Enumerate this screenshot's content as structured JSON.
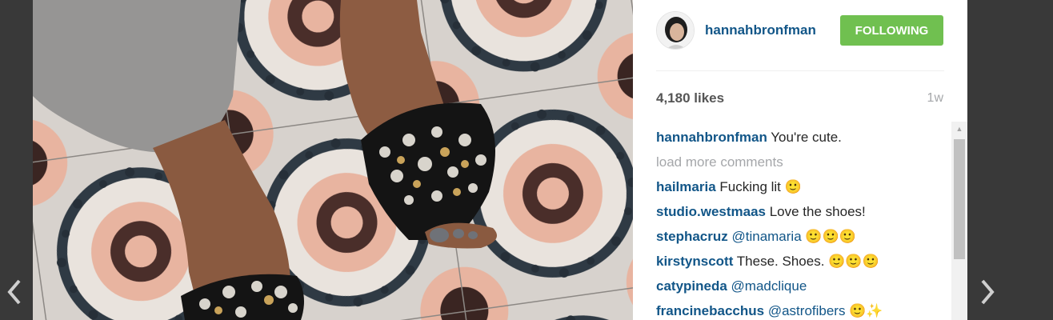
{
  "post": {
    "username": "hannahbronfman",
    "follow_label": "FOLLOWING",
    "likes": "4,180 likes",
    "age": "1w"
  },
  "comments": {
    "load_more": "load more comments",
    "items": [
      {
        "author": "hannahbronfman",
        "mention": "",
        "text": " You're cute."
      },
      {
        "author": "hailmaria",
        "mention": "",
        "text": " Fucking lit 🙂"
      },
      {
        "author": "studio.westmaas",
        "mention": "",
        "text": " Love the shoes!"
      },
      {
        "author": "stephacruz",
        "mention": "@tinamaria",
        "text": " 🙂🙂🙂"
      },
      {
        "author": "kirstynscott",
        "mention": "",
        "text": " These. Shoes. 🙂🙂🙂"
      },
      {
        "author": "catypineda",
        "mention": "@madclique",
        "text": ""
      },
      {
        "author": "francinebacchus",
        "mention": "@astrofibers",
        "text": " 🙂✨"
      }
    ]
  },
  "icons": {
    "prev": "chevron-left-icon",
    "next": "chevron-right-icon"
  },
  "colors": {
    "link": "#125688",
    "follow_button": "#70c050",
    "muted": "#a5a7aa"
  }
}
